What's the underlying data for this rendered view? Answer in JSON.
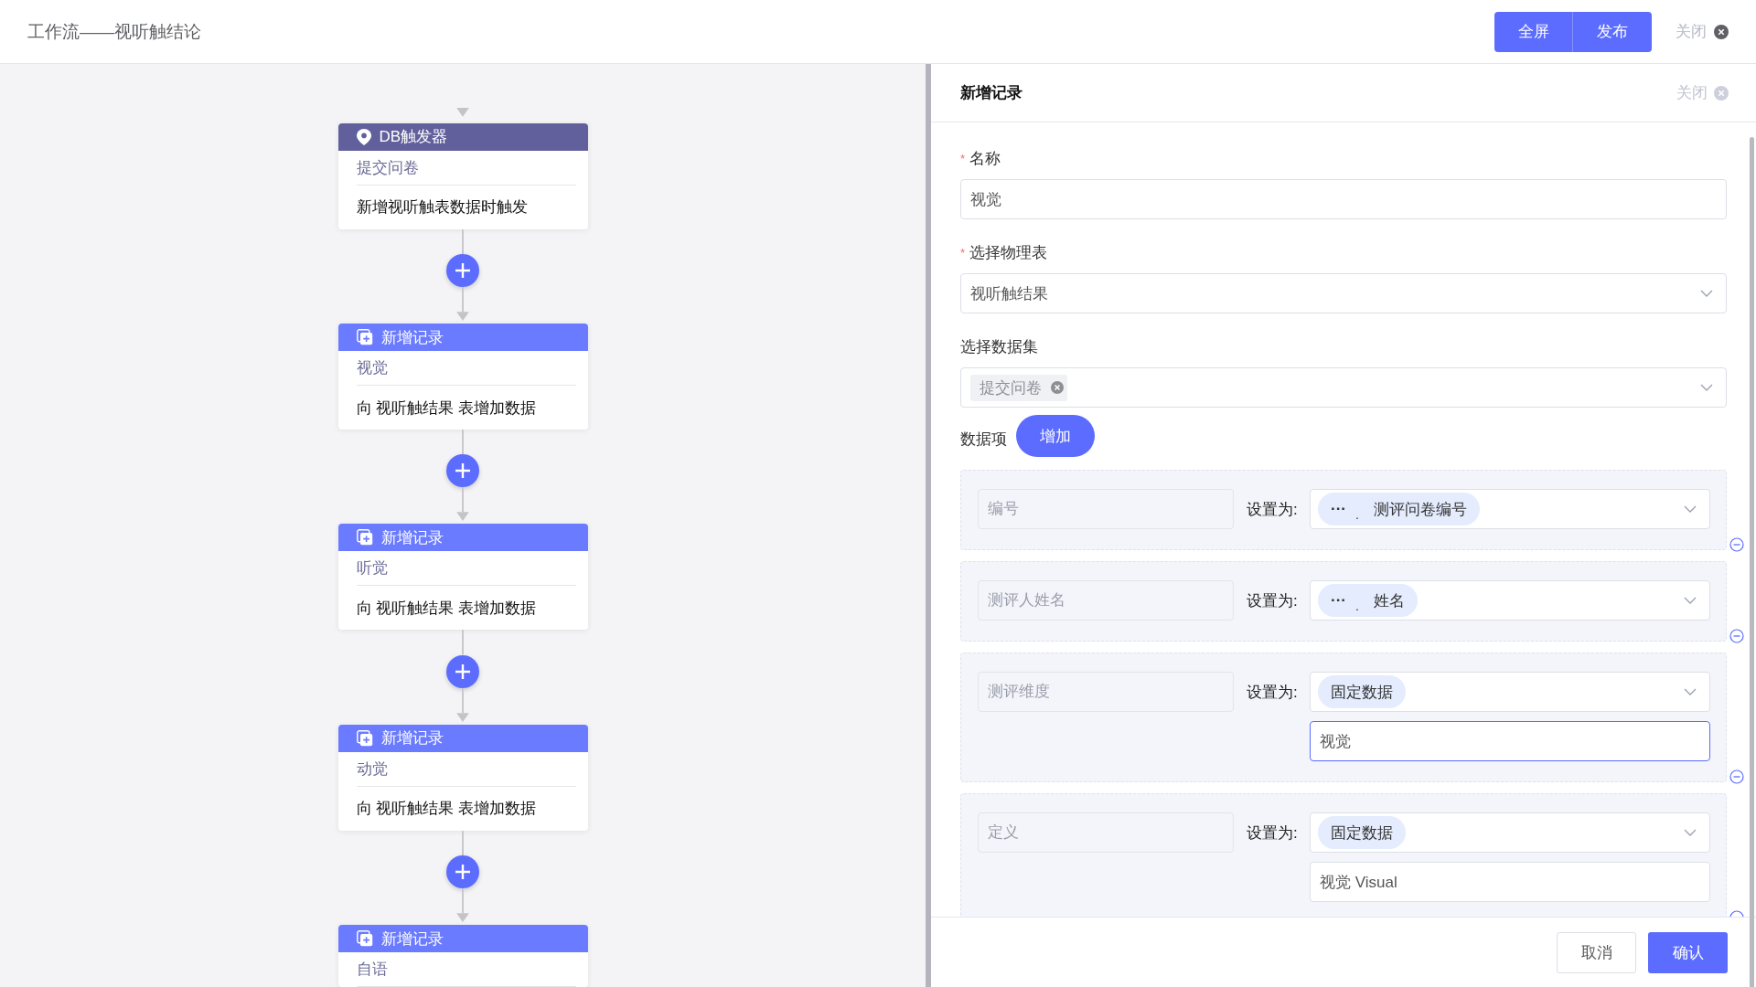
{
  "header": {
    "title": "工作流——视听触结论",
    "buttons": [
      {
        "label": "全屏"
      },
      {
        "label": "发布"
      }
    ],
    "close": {
      "label": "关闭"
    }
  },
  "flow": {
    "nodes": [
      {
        "kind": "trigger",
        "title": "DB触发器",
        "subtitle": "提交问卷",
        "description": "新增视听触表数据时触发"
      },
      {
        "kind": "record",
        "title": "新增记录",
        "subtitle": "视觉",
        "description": "向 视听触结果 表增加数据"
      },
      {
        "kind": "record",
        "title": "新增记录",
        "subtitle": "听觉",
        "description": "向 视听触结果 表增加数据"
      },
      {
        "kind": "record",
        "title": "新增记录",
        "subtitle": "动觉",
        "description": "向 视听触结果 表增加数据"
      },
      {
        "kind": "record",
        "title": "新增记录",
        "subtitle": "自语"
      }
    ]
  },
  "panel": {
    "title": "新增记录",
    "close": {
      "label": "关闭"
    },
    "required_mark": "*",
    "fields": [
      {
        "kind": "input",
        "label": "名称",
        "required": true,
        "value": "视觉"
      },
      {
        "kind": "select",
        "label": "选择物理表",
        "required": true,
        "value": "视听触结果"
      },
      {
        "kind": "tags",
        "label": "选择数据集",
        "required": false,
        "tags": [
          "提交问卷"
        ]
      }
    ],
    "items_label": "数据项",
    "add_button": "增加",
    "items": [
      {
        "kind": "field",
        "placeholder": "编号",
        "set_label": "设置为:",
        "chip_prefix": "···",
        "chip_separator": ".",
        "chip": "测评问卷编号"
      },
      {
        "kind": "field",
        "placeholder": "测评人姓名",
        "set_label": "设置为:",
        "chip_prefix": "···",
        "chip_separator": ".",
        "chip": "姓名"
      },
      {
        "kind": "fixed",
        "placeholder": "测评维度",
        "set_label": "设置为:",
        "chip": "固定数据",
        "value": "视觉",
        "focused": true
      },
      {
        "kind": "fixed",
        "placeholder": "定义",
        "set_label": "设置为:",
        "chip": "固定数据",
        "value": "视觉 Visual",
        "focused": false
      }
    ],
    "footer": {
      "cancel": "取消",
      "confirm": "确认"
    }
  }
}
